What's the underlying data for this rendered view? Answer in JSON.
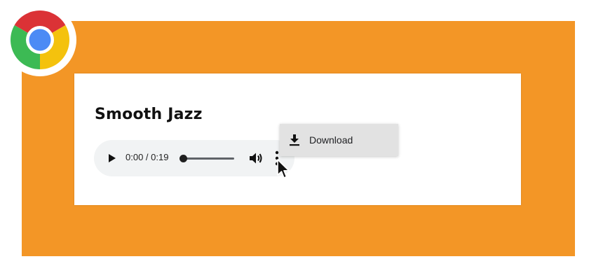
{
  "page": {
    "title": "Smooth Jazz"
  },
  "player": {
    "time_display": "0:00 / 0:19",
    "progress_fraction": 0.0
  },
  "menu": {
    "download_label": "Download"
  },
  "icons": {
    "play": "play-icon",
    "volume": "volume-icon",
    "more": "more-vert-icon",
    "download": "download-icon",
    "cursor": "mouse-cursor-icon",
    "browser": "chrome-logo"
  },
  "colors": {
    "frame": "#f39626",
    "card": "#ffffff",
    "player_bg": "#f1f3f4",
    "menu_bg": "#e2e2e2"
  }
}
